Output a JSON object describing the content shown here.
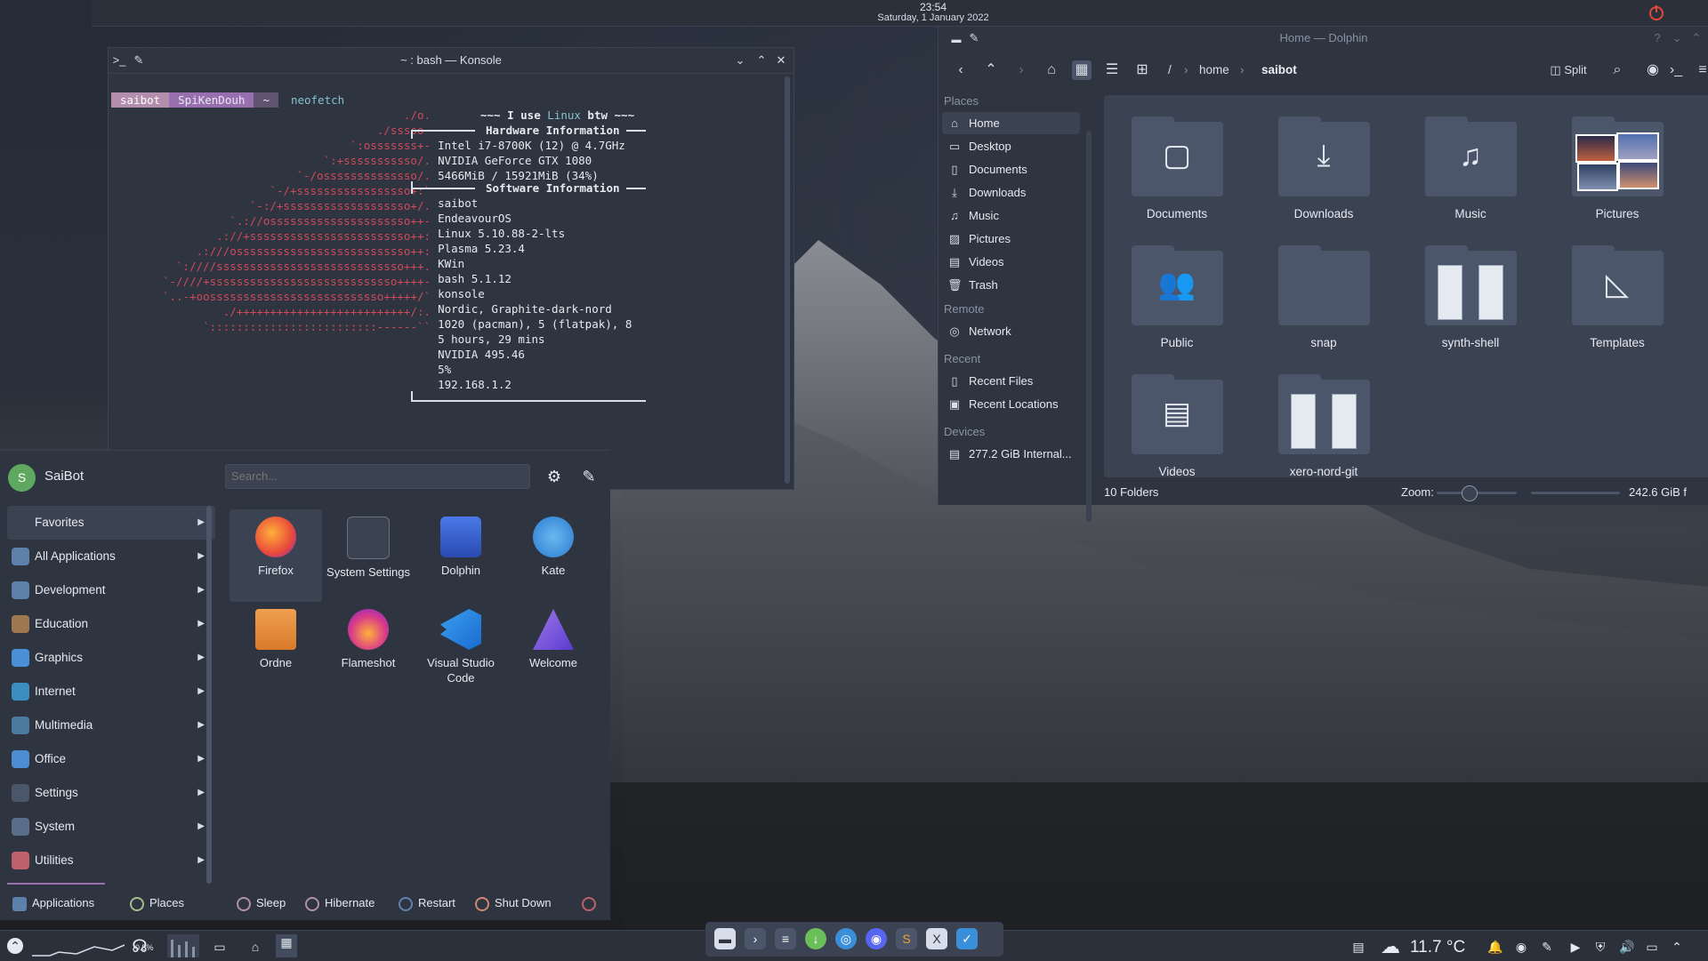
{
  "top_panel": {
    "time": "23:54",
    "date": "Saturday, 1 January 2022"
  },
  "konsole": {
    "title": "~ : bash — Konsole",
    "prompt": {
      "user": "saibot",
      "host": "SpiKenDouh",
      "dir": "~",
      "command": "neofetch"
    },
    "ascii": [
      "./o.",
      "./sssso-",
      "`:osssssss+-",
      "`:+sssssssssso/.",
      "`-/ossssssssssssso/.",
      "`-/+sssssssssssssssso+:`",
      "`-:/+sssssssssssssssssso+/.",
      "`.://osssssssssssssssssssso++-",
      ".://+ssssssssssssssssssssssso++:",
      ".:///ossssssssssssssssssssssssso++:",
      "`:////ssssssssssssssssssssssssssso+++.",
      "`-////+ssssssssssssssssssssssssssso++++-",
      "`..-+oossssssssssssssssssssssssso+++++/`",
      "./++++++++++++++++++++++++++/:.",
      "`:::::::::::::::::::::::::------``"
    ],
    "hw_title": "Hardware Information",
    "sw_title": "Software Information",
    "banner_prefix": "~~~ I use ",
    "banner_linux": "Linux",
    "banner_suffix": " btw ~~~",
    "hardware": [
      "Intel i7-8700K (12) @ 4.7GHz",
      "NVIDIA GeForce GTX 1080",
      "5466MiB / 15921MiB (34%)"
    ],
    "software": [
      "saibot",
      "EndeavourOS",
      "Linux 5.10.88-2-lts",
      "Plasma 5.23.4",
      "KWin",
      "bash 5.1.12",
      "konsole",
      "Nordic, Graphite-dark-nord",
      "1020 (pacman), 5 (flatpak), 8",
      "5 hours, 29 mins",
      "NVIDIA 495.46",
      "5%",
      "192.168.1.2"
    ],
    "glyph": "",
    "colors": [
      "#d8dee9",
      "#bf616a",
      "#d8dee9",
      "#ebcb8b",
      "#81a1c1",
      "#b48ead",
      "#88c0d0",
      "#e5e9f0"
    ]
  },
  "dolphin": {
    "title": "Home — Dolphin",
    "split_label": "Split",
    "breadcrumb": [
      "/",
      "home",
      "saibot"
    ],
    "places_sections": {
      "places": "Places",
      "remote": "Remote",
      "recent": "Recent",
      "devices": "Devices"
    },
    "places": [
      "Home",
      "Desktop",
      "Documents",
      "Downloads",
      "Music",
      "Pictures",
      "Videos",
      "Trash"
    ],
    "remote": [
      "Network"
    ],
    "recent": [
      "Recent Files",
      "Recent Locations"
    ],
    "devices": [
      "277.2 GiB Internal..."
    ],
    "folders": [
      "Documents",
      "Downloads",
      "Music",
      "Pictures",
      "Public",
      "snap",
      "synth-shell",
      "Templates",
      "Videos",
      "xero-nord-git"
    ],
    "status_count": "10 Folders",
    "zoom_label": "Zoom:",
    "free_space": "242.6 GiB f"
  },
  "launcher": {
    "user": "SaiBot",
    "avatar_letter": "S",
    "search_placeholder": "Search...",
    "categories": [
      "Favorites",
      "All Applications",
      "Development",
      "Education",
      "Graphics",
      "Internet",
      "Multimedia",
      "Office",
      "Settings",
      "System",
      "Utilities"
    ],
    "category_colors": [
      "#3b4252",
      "#5e81ac",
      "#5e81ac",
      "#a07850",
      "#4a90d9",
      "#3a8fc0",
      "#4a7aa0",
      "#4c8cd0",
      "#4c566a",
      "#5a6e8a",
      "#bf616a"
    ],
    "apps": [
      {
        "name": "Firefox",
        "color": "#e8683a"
      },
      {
        "name": "System Settings",
        "color": "#4c566a"
      },
      {
        "name": "Dolphin",
        "color": "#3a6ed8"
      },
      {
        "name": "Kate",
        "color": "#3a8fd8"
      },
      {
        "name": "Ordne",
        "color": "#e88a3a"
      },
      {
        "name": "Flameshot",
        "color": "#9a3ab0"
      },
      {
        "name": "Visual Studio Code",
        "color": "#2a7ad0"
      },
      {
        "name": "Welcome",
        "color": "#7a5ad0"
      }
    ],
    "tabs": {
      "applications": "Applications",
      "places": "Places"
    },
    "power": {
      "sleep": "Sleep",
      "hibernate": "Hibernate",
      "restart": "Restart",
      "shutdown": "Shut Down"
    }
  },
  "bottom_panel": {
    "cpu_label": "0.5%",
    "weather": "11.7 °C"
  }
}
